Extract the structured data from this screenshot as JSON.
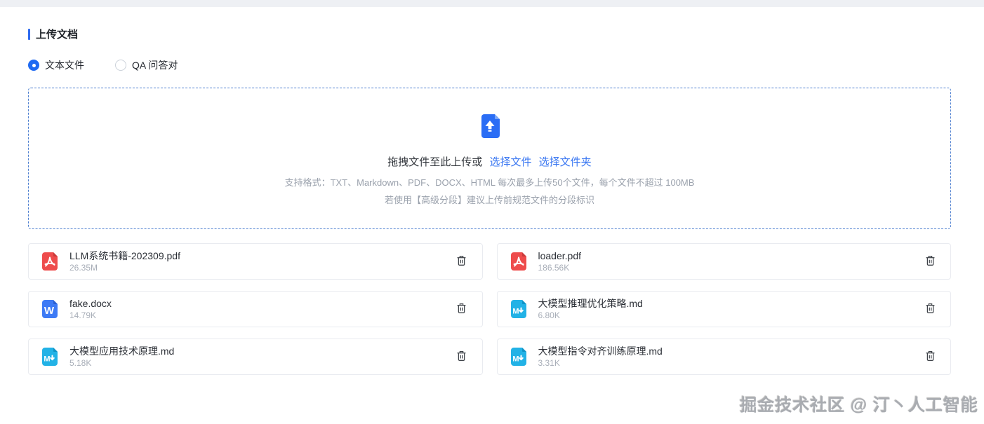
{
  "page": {
    "title": "上传文档",
    "watermark": "掘金技术社区 @ 汀丶人工智能"
  },
  "radio_group": {
    "options": [
      {
        "label": "文本文件",
        "selected": true
      },
      {
        "label": "QA 问答对",
        "selected": false
      }
    ]
  },
  "dropzone": {
    "main_text": "拖拽文件至此上传或",
    "link_select_file": "选择文件",
    "link_select_folder": "选择文件夹",
    "hint_line1": "支持格式：TXT、Markdown、PDF、DOCX、HTML 每次最多上传50个文件，每个文件不超过 100MB",
    "hint_line2": "若使用【高级分段】建议上传前规范文件的分段标识",
    "upload_icon": "file-upload-icon"
  },
  "files": [
    {
      "name": "LLM系统书籍-202309.pdf",
      "size": "26.35M",
      "type": "pdf"
    },
    {
      "name": "loader.pdf",
      "size": "186.56K",
      "type": "pdf"
    },
    {
      "name": "fake.docx",
      "size": "14.79K",
      "type": "docx"
    },
    {
      "name": "大模型推理优化策略.md",
      "size": "6.80K",
      "type": "md"
    },
    {
      "name": "大模型应用技术原理.md",
      "size": "5.18K",
      "type": "md"
    },
    {
      "name": "大模型指令对齐训练原理.md",
      "size": "3.31K",
      "type": "md"
    }
  ],
  "icons": {
    "delete": "trash-icon",
    "pdf": "pdf-file-icon",
    "docx": "word-file-icon",
    "md": "markdown-file-icon"
  },
  "colors": {
    "accent_blue": "#2f6bf0",
    "link_blue": "#3a77f2",
    "dropzone_border": "#4d7fd0",
    "pdf_red": "#ee4c4c",
    "docx_blue": "#3d7af5",
    "md_cyan": "#22b2e6",
    "hint_gray": "#9aa1ac"
  }
}
